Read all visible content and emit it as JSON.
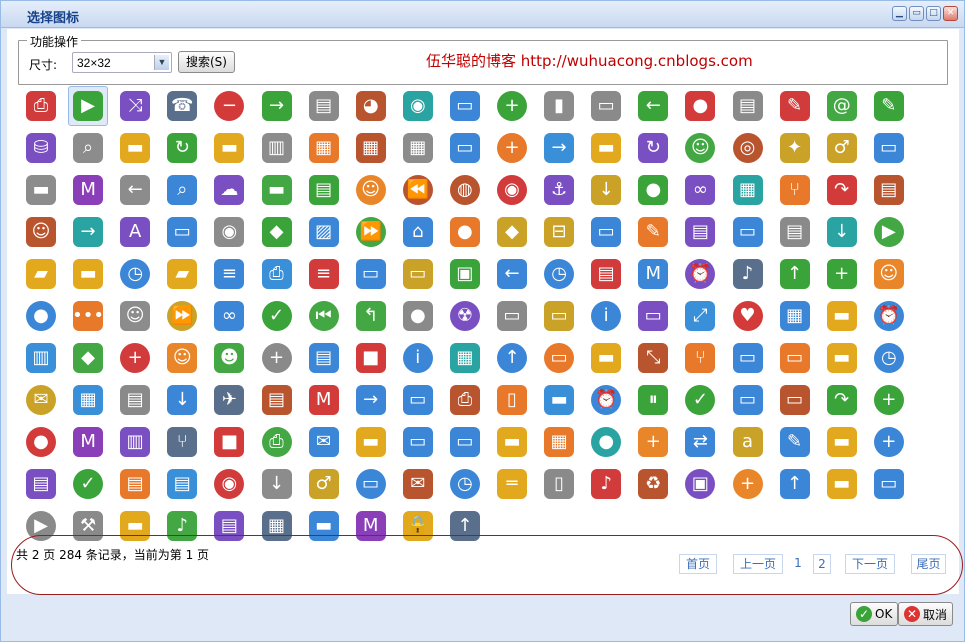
{
  "window": {
    "title": "选择图标",
    "tool_buttons": [
      "minimize",
      "restore",
      "maximize",
      "close"
    ]
  },
  "toolbar": {
    "legend": "功能操作",
    "size_label": "尺寸:",
    "size_value": "32×32",
    "search_label": "搜索(S)",
    "blog_link": "伍华聪的博客 http://wuhuacong.cnblogs.com"
  },
  "icons": [
    [
      "printer",
      "play-green",
      "shuffle",
      "phone",
      "minus-red",
      "arrow-right-green",
      "document",
      "pie-chart",
      "camera",
      "window",
      "add-green",
      "battery",
      "harddisk",
      "arrow-left-green",
      "apple-red",
      "new-document",
      "pencil-note",
      "at-sign",
      "pencil-green"
    ],
    [
      "database",
      "zoom-in",
      "bus",
      "refresh-green",
      "truck",
      "columns",
      "calendar",
      "calendar-remove",
      "abacus",
      "windows-stack",
      "add-circle",
      "arrow-right",
      "card-arrow",
      "rotate",
      "user-add",
      "cd",
      "gift",
      "runner",
      "window-blue"
    ],
    [
      "tractor",
      "mtv",
      "arrow-left",
      "search-window",
      "cloud",
      "motorcycle",
      "book-green",
      "smiley",
      "rewind",
      "lifebuoy",
      "feed",
      "anchor",
      "arrow-down",
      "apple-green",
      "chain",
      "stock-chart",
      "fork-arrow",
      "redo",
      "zip"
    ],
    [
      "angel",
      "arrow-right-long",
      "app-store",
      "window-download",
      "speaker",
      "android",
      "picture-window",
      "forward",
      "home-window",
      "apple-store",
      "browser",
      "tag",
      "window-warning",
      "pencils",
      "news",
      "windows-cascade",
      "document-export",
      "arrow-down-long",
      "play-circle"
    ],
    [
      "ruler-pencil",
      "forklift",
      "clock-alert",
      "ruler",
      "list-window",
      "printer-black",
      "list",
      "window-up",
      "form",
      "box-green",
      "arrow-left-blue",
      "clock-add",
      "book-closed",
      "mtv-window",
      "alarm",
      "ipod",
      "arrow-up-green",
      "plus-green",
      "contact-book"
    ],
    [
      "circle-blue",
      "dots",
      "user-support",
      "fast-forward",
      "link-window",
      "check-green",
      "skip-back",
      "turn-left",
      "apple-grey",
      "radiation",
      "switch",
      "terminal",
      "info",
      "note-remove",
      "expand",
      "heart-add",
      "blueprint",
      "cart",
      "alarm-clock"
    ],
    [
      "panel-left",
      "arrow-diag",
      "address-book",
      "contact-orange",
      "alien",
      "add-grey",
      "blue-book",
      "stop-red",
      "info-blue",
      "chart-bars",
      "arrow-up-circle",
      "note-add",
      "camper",
      "collapse",
      "branch",
      "window-full",
      "speech",
      "car",
      "clock"
    ],
    [
      "envelope-add",
      "grid-pencil",
      "document-down",
      "arrow-down-blue",
      "plane",
      "notepad",
      "mtv-red",
      "arrow-right-blue",
      "blank-window",
      "fax",
      "mobile",
      "ambulance",
      "alarm-blue",
      "pause-green",
      "check-circle",
      "window-out",
      "console",
      "redo-green",
      "add-olive"
    ],
    [
      "circle-minus",
      "mtv-purple",
      "panel-dots",
      "merge",
      "stop-sign",
      "print-add",
      "mail-window",
      "taxi",
      "window-grey",
      "window-blue2",
      "businessman",
      "spreadsheet",
      "circle-cut",
      "plus-orange",
      "sync",
      "amazon",
      "edit-window",
      "excavator",
      "plus-blue"
    ],
    [
      "file-cabinet",
      "check-ok",
      "book-down",
      "folder-files",
      "rss",
      "arrow-down-right",
      "running-man",
      "window-add",
      "mail",
      "clock-notify",
      "level",
      "fridge",
      "ipod-black",
      "recycle",
      "box-add",
      "add-orange",
      "arrow-up-blue",
      "dump-truck",
      "windows"
    ],
    [
      "play-dark",
      "hammer",
      "forklift-box",
      "music-player",
      "newspaper",
      "dashboard",
      "card-window",
      "mtv-black",
      "lock",
      "arrow-up-long"
    ]
  ],
  "selected_icon": "play-green",
  "footer": {
    "record_info": "共 2 页 284 条记录，当前为第 1 页",
    "first": "首页",
    "prev": "上一页",
    "page1": "1",
    "page2": "2",
    "next": "下一页",
    "last": "尾页",
    "ok": "OK",
    "cancel": "取消"
  }
}
